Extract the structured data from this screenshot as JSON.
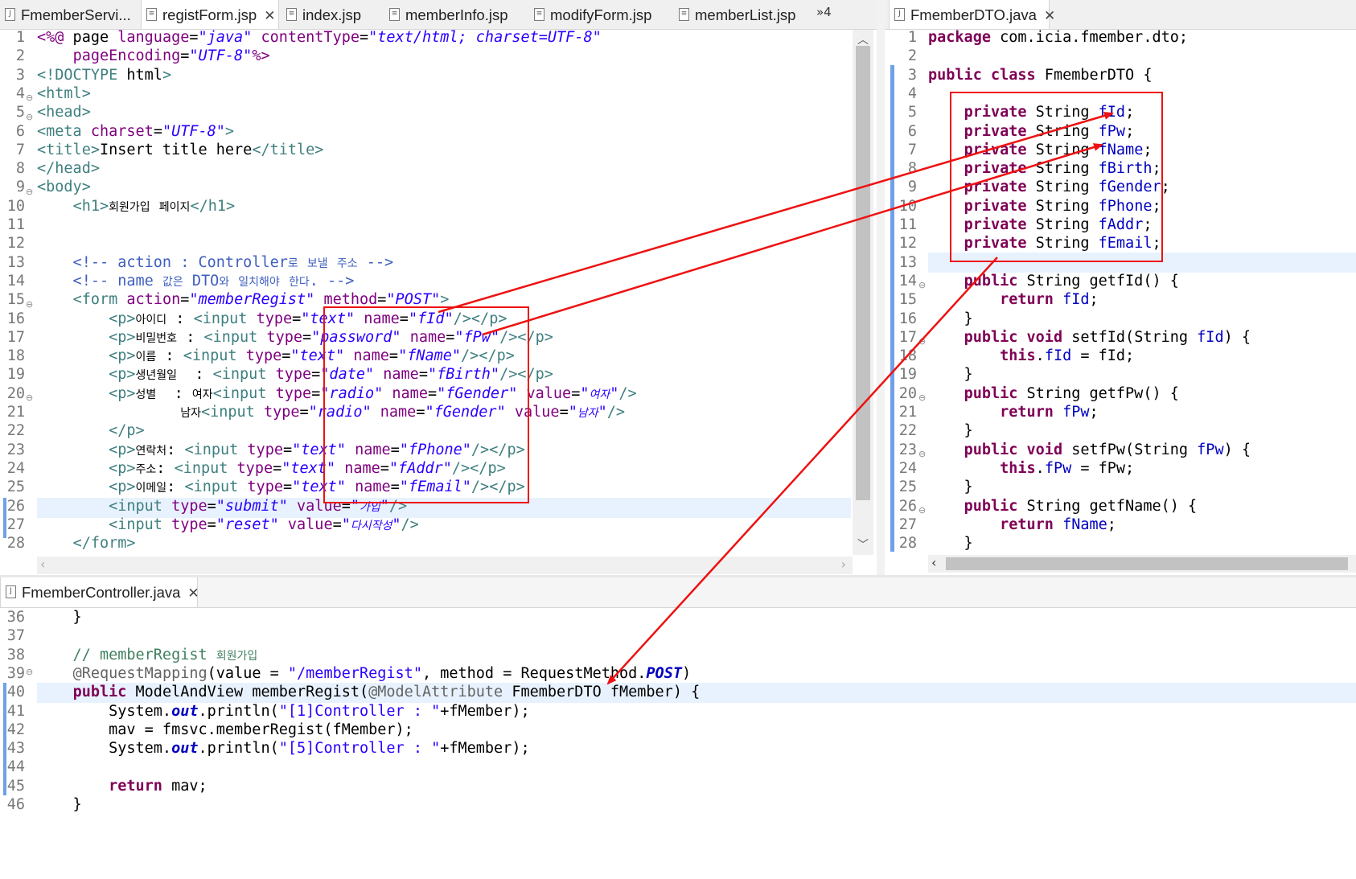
{
  "editor_tabs": [
    "FmemberServi...",
    "registForm.jsp",
    "index.jsp",
    "memberInfo.jsp",
    "modifyForm.jsp",
    "memberList.jsp"
  ],
  "overflow_tabs_count": "»4",
  "dto_tab": "FmemberDTO.java",
  "controller_tab": "FmemberController.java",
  "jsp_line_numbers": [
    "1",
    "2",
    "3",
    "4",
    "5",
    "6",
    "7",
    "8",
    "9",
    "10",
    "11",
    "12",
    "13",
    "14",
    "15",
    "16",
    "17",
    "18",
    "19",
    "20",
    "21",
    "22",
    "23",
    "24",
    "25",
    "26",
    "27",
    "28"
  ],
  "jsp_code": [
    "<%@ page language=\"java\" contentType=\"text/html; charset=UTF-8\"",
    "    pageEncoding=\"UTF-8\"%>",
    "<!DOCTYPE html>",
    "<html>",
    "<head>",
    "<meta charset=\"UTF-8\">",
    "<title>Insert title here</title>",
    "</head>",
    "<body>",
    "    <h1>회원가입 페이지</h1>",
    "",
    "",
    "    <!-- action : Controller로 보낼 주소 -->",
    "    <!-- name 값은 DTO와 일치해야 한다. -->",
    "    <form action=\"memberRegist\" method=\"POST\">",
    "        <p>아이디 : <input type=\"text\" name=\"fId\"/></p>",
    "        <p>비밀번호 : <input type=\"password\" name=\"fPw\"/></p>",
    "        <p>이름 : <input type=\"text\" name=\"fName\"/></p>",
    "        <p>생년월일  : <input type=\"date\" name=\"fBirth\"/></p>",
    "        <p>성별  : 여자<input type=\"radio\" name=\"fGender\" value=\"여자\"/>",
    "                남자<input type=\"radio\" name=\"fGender\" value=\"남자\"/>",
    "        </p>",
    "        <p>연락처: <input type=\"text\" name=\"fPhone\"/></p>",
    "        <p>주소: <input type=\"text\" name=\"fAddr\"/></p>",
    "        <p>이메일: <input type=\"text\" name=\"fEmail\"/></p>",
    "        <input type=\"submit\" value=\"가입\"/>",
    "        <input type=\"reset\" value=\"다시작성\"/>",
    "    </form>"
  ],
  "dto_line_numbers": [
    "1",
    "2",
    "3",
    "4",
    "5",
    "6",
    "7",
    "8",
    "9",
    "10",
    "11",
    "12",
    "13",
    "14",
    "15",
    "16",
    "17",
    "18",
    "19",
    "20",
    "21",
    "22",
    "23",
    "24",
    "25",
    "26",
    "27",
    "28"
  ],
  "dto_code": [
    "package com.icia.fmember.dto;",
    "",
    "public class FmemberDTO {",
    "",
    "    private String fId;",
    "    private String fPw;",
    "    private String fName;",
    "    private String fBirth;",
    "    private String fGender;",
    "    private String fPhone;",
    "    private String fAddr;",
    "    private String fEmail;",
    "",
    "    public String getfId() {",
    "        return fId;",
    "    }",
    "    public void setfId(String fId) {",
    "        this.fId = fId;",
    "    }",
    "    public String getfPw() {",
    "        return fPw;",
    "    }",
    "    public void setfPw(String fPw) {",
    "        this.fPw = fPw;",
    "    }",
    "    public String getfName() {",
    "        return fName;",
    "    }"
  ],
  "controller_line_numbers": [
    "36",
    "37",
    "38",
    "39",
    "40",
    "41",
    "42",
    "43",
    "44",
    "45",
    "46"
  ],
  "controller_code": [
    "    }",
    "",
    "    // memberRegist 회원가입",
    "    @RequestMapping(value = \"/memberRegist\", method = RequestMethod.POST)",
    "    public ModelAndView memberRegist(@ModelAttribute FmemberDTO fMember) {",
    "        System.out.println(\"[1]Controller : \"+fMember);",
    "        mav = fmsvc.memberRegist(fMember);",
    "        System.out.println(\"[5]Controller : \"+fMember);",
    "",
    "        return mav;",
    "    }"
  ],
  "icons": [
    "java-file-icon",
    "jsp-file-icon",
    "close-icon",
    "chevron-up-icon",
    "chevron-down-icon",
    "chevron-left-icon",
    "chevron-right-icon"
  ],
  "colors": {
    "keyword": "#7f0055",
    "tag": "#3f7f7f",
    "attribute": "#7f007f",
    "string": "#2a00ff",
    "comment": "#3f5fbf",
    "field": "#0000c0",
    "annotation": "#ee1111"
  }
}
